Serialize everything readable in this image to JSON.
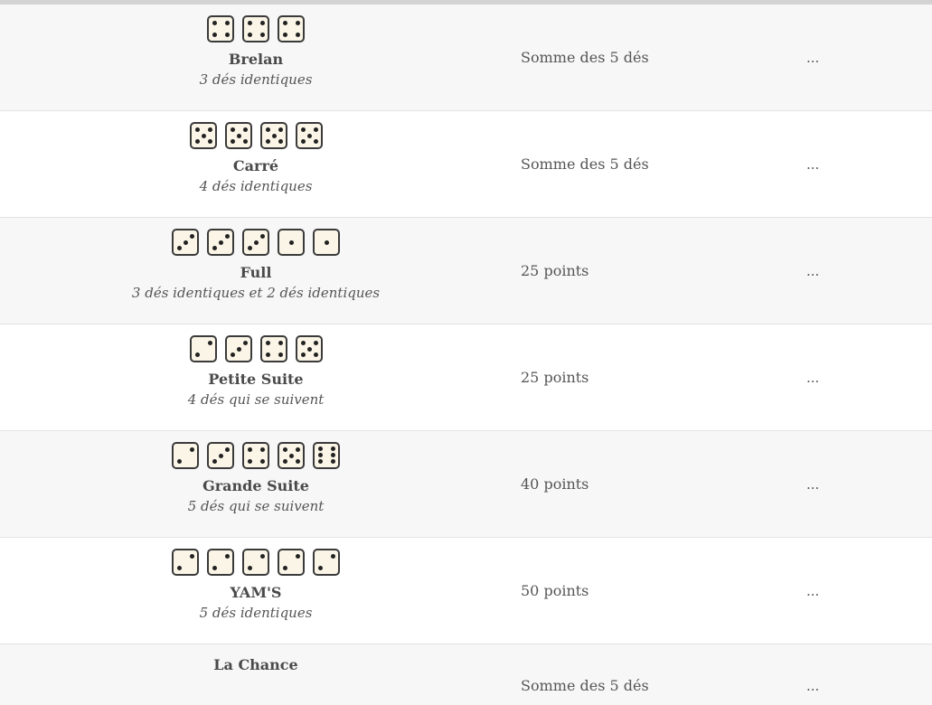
{
  "rows": [
    {
      "name": "Brelan",
      "desc": "3 dés identiques",
      "score": "Somme des 5 dés",
      "value": "...",
      "dice": [
        4,
        4,
        4
      ]
    },
    {
      "name": "Carré",
      "desc": "4 dés identiques",
      "score": "Somme des 5 dés",
      "value": "...",
      "dice": [
        5,
        5,
        5,
        5
      ]
    },
    {
      "name": "Full",
      "desc": "3 dés identiques et 2 dés identiques",
      "score": "25 points",
      "value": "...",
      "dice": [
        3,
        3,
        3,
        1,
        1
      ]
    },
    {
      "name": "Petite Suite",
      "desc": "4 dés qui se suivent",
      "score": "25 points",
      "value": "...",
      "dice": [
        2,
        3,
        4,
        5
      ]
    },
    {
      "name": "Grande Suite",
      "desc": "5 dés qui se suivent",
      "score": "40 points",
      "value": "...",
      "dice": [
        2,
        3,
        4,
        5,
        6
      ]
    },
    {
      "name": "YAM'S",
      "desc": "5 dés identiques",
      "score": "50 points",
      "value": "...",
      "dice": [
        2,
        2,
        2,
        2,
        2
      ]
    },
    {
      "name": "La Chance",
      "desc": "",
      "score": "Somme des 5 dés",
      "value": "...",
      "dice": []
    }
  ]
}
